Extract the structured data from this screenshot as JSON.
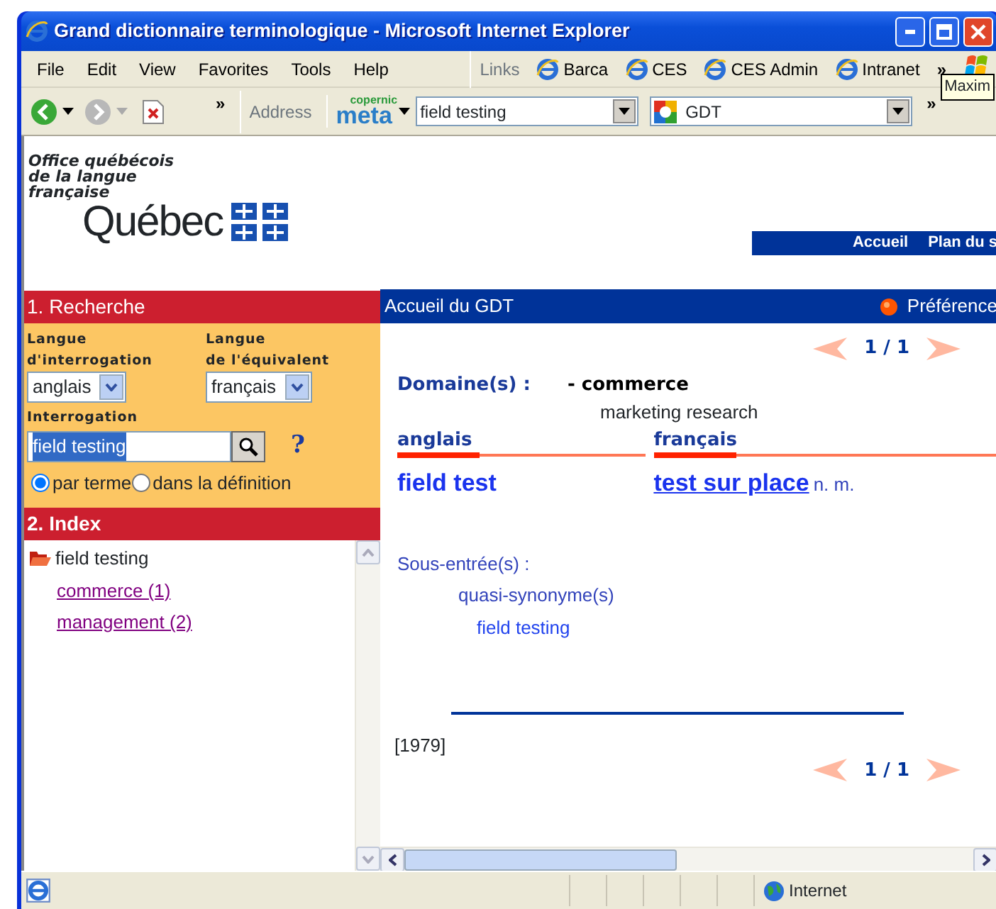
{
  "window": {
    "title": "Grand dictionnaire terminologique - Microsoft Internet Explorer"
  },
  "menu": [
    "File",
    "Edit",
    "View",
    "Favorites",
    "Tools",
    "Help"
  ],
  "links": {
    "label": "Links",
    "items": [
      "Barca",
      "CES",
      "CES Admin",
      "Intranet"
    ],
    "more": "»"
  },
  "tooltip": "Maxim",
  "toolbar": {
    "more": "»",
    "address_label": "Address",
    "logo": {
      "top": "copernic",
      "main": "meta"
    },
    "search_value": "field testing",
    "engine": "GDT",
    "more_right": "»"
  },
  "left": {
    "org": [
      "Office québécois",
      "de la langue",
      "française"
    ],
    "logo": "Québec",
    "recherche": {
      "title": "1. Recherche",
      "source": {
        "label": [
          "Langue",
          "d'interrogation"
        ],
        "value": "anglais"
      },
      "target": {
        "label": [
          "Langue",
          "de l'équivalent"
        ],
        "value": "français"
      },
      "query_label": "Interrogation",
      "query": "field testing",
      "help": "?",
      "radios": [
        {
          "label": "par terme",
          "selected": true
        },
        {
          "label": "dans la définition",
          "selected": false
        }
      ]
    },
    "index": {
      "title": "2. Index",
      "items": [
        {
          "label": "field testing",
          "children": [
            {
              "label": "commerce (1)"
            },
            {
              "label": "management (2)"
            }
          ]
        }
      ]
    }
  },
  "right": {
    "nav": [
      "Accueil",
      "Plan du s"
    ],
    "bar": {
      "title": "Accueil du GDT",
      "prefs": "Préférence"
    },
    "pager_top": "1 / 1",
    "domain": {
      "label": "Domaine(s) :",
      "value": "- commerce",
      "sub": "marketing research"
    },
    "columns": [
      {
        "language": "anglais",
        "term": "field test",
        "link": false
      },
      {
        "language": "français",
        "term": "test sur place",
        "grammar": "n. m.",
        "link": true
      }
    ],
    "subentries": {
      "label": "Sous-entrée(s) :",
      "type": "quasi-synonyme(s)",
      "term": "field testing"
    },
    "source": "[1979]",
    "pager_bottom": "1 / 1"
  },
  "status": {
    "zone": "Internet"
  }
}
